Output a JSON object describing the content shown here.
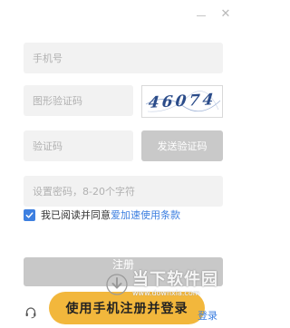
{
  "window": {
    "minimize_icon": "minimize-icon",
    "close_label": "✕"
  },
  "form": {
    "phone_placeholder": "手机号",
    "graphic_code_placeholder": "图形验证码",
    "captcha_text": "46074",
    "sms_code_placeholder": "验证码",
    "send_code_label": "发送验证码",
    "password_placeholder": "设置密码，8-20个字符"
  },
  "agreement": {
    "checked": true,
    "text": "我已阅读并同意",
    "link": "爱加速使用条款"
  },
  "register_label": "注册",
  "bottom": {
    "support_icon": "headset-icon",
    "phone_register_label": "使用手机注册并登录",
    "login_link": "登录"
  },
  "watermark": {
    "title": "当下软件园",
    "url": "www.downxia.com"
  },
  "colors": {
    "accent_blue": "#3d7fe0",
    "primary_yellow": "#f2b73c",
    "disabled_gray": "#c8c8c8",
    "field_bg": "#f2f2f2"
  }
}
